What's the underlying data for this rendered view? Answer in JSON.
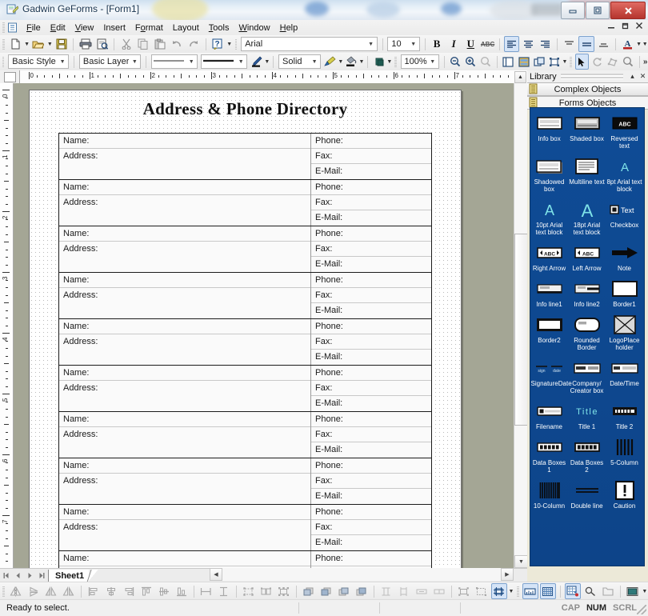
{
  "window": {
    "title": "Gadwin GeForms - [Form1]",
    "icon": "form-document-icon",
    "buttons": {
      "minimize": "–",
      "maximize": "□",
      "close": "✕"
    }
  },
  "menubar": {
    "items": [
      {
        "label": "File"
      },
      {
        "label": "Edit"
      },
      {
        "label": "View"
      },
      {
        "label": "Insert"
      },
      {
        "label": "Format"
      },
      {
        "label": "Layout"
      },
      {
        "label": "Tools"
      },
      {
        "label": "Window"
      },
      {
        "label": "Help"
      }
    ],
    "mdi_controls": [
      {
        "name": "mdi-minimize",
        "glyph": "–"
      },
      {
        "name": "mdi-restore",
        "glyph": "❐"
      },
      {
        "name": "mdi-close",
        "glyph": "✕"
      }
    ]
  },
  "toolbar_main": {
    "buttons": [
      {
        "name": "new-document-button",
        "icon": "new-page-icon",
        "dropdown": true
      },
      {
        "name": "open-document-button",
        "icon": "open-folder-icon",
        "dropdown": true
      },
      {
        "name": "save-document-button",
        "icon": "floppy-disk-icon",
        "dropdown": false
      },
      {
        "name": "print-button",
        "icon": "printer-icon",
        "dropdown": false
      },
      {
        "name": "print-preview-button",
        "icon": "print-preview-icon",
        "dropdown": false
      },
      {
        "name": "cut-button",
        "icon": "scissors-icon",
        "dropdown": false
      },
      {
        "name": "copy-button",
        "icon": "copy-icon",
        "dropdown": false
      },
      {
        "name": "paste-button",
        "icon": "clipboard-icon",
        "dropdown": false
      },
      {
        "name": "undo-button",
        "icon": "undo-arrow-icon",
        "dropdown": false
      },
      {
        "name": "redo-button",
        "icon": "redo-arrow-icon",
        "dropdown": false
      },
      {
        "name": "help-button",
        "icon": "question-mark-icon",
        "dropdown": true
      }
    ],
    "font_name": "Arial",
    "font_size": "10",
    "bold_label": "B",
    "italic_label": "I",
    "underline_label": "U",
    "strikethrough_label": "ABC",
    "align_left": "align-left-icon",
    "align_center": "align-center-icon",
    "align_right": "align-right-icon",
    "valign_top": "valign-top-icon",
    "valign_middle": "valign-middle-icon",
    "valign_bottom": "valign-bottom-icon",
    "font_color": "A",
    "overflow_label": "»"
  },
  "toolbar_format": {
    "style": "Basic Style",
    "layer": "Basic Layer",
    "line_style_1": "thin-line-sample",
    "line_style_2": "thick-line-sample",
    "pen_tool": "pen-icon",
    "fill_style": "Solid",
    "brush_tool": "brush-icon",
    "bucket_tool": "paint-bucket-icon",
    "shadow_tool": "shadow-color-icon",
    "zoom_value": "100%",
    "zoom_out": "zoom-out-icon",
    "zoom_in": "zoom-in-icon",
    "zoom_reset": "zoom-reset-icon",
    "view_page": "page-view-icon",
    "view_layout": "layout-view-icon",
    "view_duplicate": "duplicate-view-icon",
    "view_bounds": "bounds-view-icon",
    "select_tool": "arrow-pointer-icon",
    "rotate_tool": "rotate-icon",
    "polygon_tool": "polygon-edit-icon",
    "magnify_tool": "magnifier-icon",
    "overflow_label": "»"
  },
  "ruler": {
    "horizontal_labels": [
      "0",
      "1",
      "2",
      "3",
      "4",
      "5",
      "6",
      "7"
    ],
    "vertical_labels": [
      "0",
      "1",
      "2",
      "3",
      "4",
      "5",
      "6",
      "7"
    ],
    "unit": "inches"
  },
  "document": {
    "title": "Address & Phone Directory",
    "left_labels": [
      "Name:",
      "Address:"
    ],
    "right_labels": [
      "Phone:",
      "Fax:",
      "E-Mail:"
    ],
    "record_count": 10
  },
  "tabbar": {
    "nav": [
      {
        "name": "first-sheet-button",
        "glyph": "⏮"
      },
      {
        "name": "prev-sheet-button",
        "glyph": "◀"
      },
      {
        "name": "next-sheet-button",
        "glyph": "▶"
      },
      {
        "name": "last-sheet-button",
        "glyph": "⏭"
      }
    ],
    "sheet_name": "Sheet1"
  },
  "toolbar_align": {
    "groups": [
      [
        "flip-horizontal-icon",
        "flip-vertical-icon",
        "mirror-horizontal-icon",
        "mirror-vertical-icon"
      ],
      [
        "align-objects-left-icon",
        "align-objects-center-icon",
        "align-objects-right-icon",
        "align-objects-top-icon",
        "align-objects-middle-icon",
        "align-objects-bottom-icon"
      ],
      [
        "distribute-horizontal-icon",
        "distribute-vertical-icon"
      ],
      [
        "group-objects-icon",
        "ungroup-objects-icon",
        "regroup-objects-icon"
      ],
      [
        "bring-to-front-icon",
        "bring-forward-icon",
        "send-backward-icon",
        "send-to-back-icon"
      ],
      [
        "same-height-icon",
        "same-width-icon",
        "stretch-horizontal-icon",
        "stretch-vertical-icon"
      ],
      [
        "nudge-objects-icon",
        "resize-objects-icon",
        "snap-to-grid-icon"
      ],
      [
        "show-ruler-icon",
        "show-grid-icon"
      ],
      [
        "snap-settings-icon",
        "lock-objects-icon",
        "object-properties-icon",
        "preview-icon"
      ]
    ]
  },
  "statusbar": {
    "message": "Ready to select.",
    "indicators": [
      {
        "label": "CAP",
        "active": false
      },
      {
        "label": "NUM",
        "active": true
      },
      {
        "label": "SCRL",
        "active": false
      }
    ]
  },
  "library": {
    "title": "Library",
    "collapse_glyph": "▴",
    "close_glyph": "✕",
    "tabs": [
      {
        "label": "Complex Objects",
        "selected": false
      },
      {
        "label": "Forms Objects",
        "selected": true
      }
    ],
    "items": [
      {
        "label": "Info box",
        "icon": "info-box-icon"
      },
      {
        "label": "Shaded box",
        "icon": "shaded-box-icon"
      },
      {
        "label": "Reversed text",
        "icon": "reversed-text-icon"
      },
      {
        "label": "Shadowed box",
        "icon": "shadowed-box-icon"
      },
      {
        "label": "Multiline text",
        "icon": "multiline-text-icon"
      },
      {
        "label": "8pt Arial text block",
        "icon": "text-block-8pt-icon"
      },
      {
        "label": "10pt Arial text block",
        "icon": "text-block-10pt-icon"
      },
      {
        "label": "18pt Arial text block",
        "icon": "text-block-18pt-icon"
      },
      {
        "label": "Checkbox",
        "icon": "checkbox-icon"
      },
      {
        "label": "Right Arrow",
        "icon": "right-arrow-box-icon"
      },
      {
        "label": "Left Arrow",
        "icon": "left-arrow-box-icon"
      },
      {
        "label": "Note",
        "icon": "note-arrow-icon"
      },
      {
        "label": "Info line1",
        "icon": "info-line1-icon"
      },
      {
        "label": "Info line2",
        "icon": "info-line2-icon"
      },
      {
        "label": "Border1",
        "icon": "border1-icon"
      },
      {
        "label": "Border2",
        "icon": "border2-icon"
      },
      {
        "label": "Rounded Border",
        "icon": "rounded-border-icon"
      },
      {
        "label": "LogoPlace holder",
        "icon": "logo-placeholder-icon"
      },
      {
        "label": "SignatureDate",
        "icon": "signature-date-icon"
      },
      {
        "label": "Company/ Creator box",
        "icon": "company-creator-box-icon"
      },
      {
        "label": "Date/Time",
        "icon": "date-time-icon"
      },
      {
        "label": "Filename",
        "icon": "filename-icon"
      },
      {
        "label": "Title 1",
        "icon": "title1-icon"
      },
      {
        "label": "Title 2",
        "icon": "title2-icon"
      },
      {
        "label": "Data Boxes 1",
        "icon": "data-boxes1-icon"
      },
      {
        "label": "Data Boxes 2",
        "icon": "data-boxes2-icon"
      },
      {
        "label": "5-Column",
        "icon": "five-column-icon"
      },
      {
        "label": "10-Column",
        "icon": "ten-column-icon"
      },
      {
        "label": "Double line",
        "icon": "double-line-icon"
      },
      {
        "label": "Caution",
        "icon": "caution-icon"
      }
    ]
  },
  "colors": {
    "library_bg": "#0f4c96",
    "library_text": "#ffffff",
    "desk_bg": "#a4a695",
    "accent": "#1b6ec2"
  }
}
